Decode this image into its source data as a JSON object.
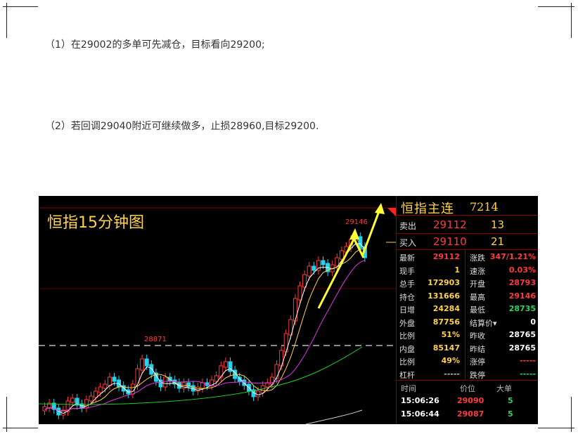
{
  "article": {
    "line1": "（1）在29002的多单可先减仓，目标看向29200;",
    "line2": "（2）若回调29040附近可继续做多，止损28960,目标29200."
  },
  "chart": {
    "title": "恒指15分钟图",
    "peak_label": "29146",
    "low_label": "28871",
    "colors": {
      "up": "#ff3b3b",
      "down": "#22d3ee",
      "ma_white": "#ffffff",
      "ma_yellow": "#ffd24d",
      "ma_magenta": "#e135e1",
      "ma_green": "#22cc22",
      "arrow": "#ffff33"
    }
  },
  "quote": {
    "title": "恒指主连",
    "code": "7214",
    "sell_label": "卖出",
    "sell_price": "29112",
    "sell_qty": "13",
    "buy_label": "买入",
    "buy_price": "29110",
    "buy_qty": "21",
    "stats": [
      {
        "l1": "最新",
        "v1": "29112",
        "c1": "red",
        "l2": "涨跌",
        "v2": "347/1.21%",
        "c2": "red"
      },
      {
        "l1": "现手",
        "v1": "1",
        "c1": "yellow",
        "l2": "速涨",
        "v2": "0.03%",
        "c2": "red"
      },
      {
        "l1": "总手",
        "v1": "172903",
        "c1": "yellow",
        "l2": "开盘",
        "v2": "28793",
        "c2": "red"
      },
      {
        "l1": "持仓",
        "v1": "131666",
        "c1": "yellow",
        "l2": "最高",
        "v2": "29146",
        "c2": "red"
      },
      {
        "l1": "日增",
        "v1": "24284",
        "c1": "yellow",
        "l2": "最低",
        "v2": "28735",
        "c2": "green"
      },
      {
        "l1": "外盘",
        "v1": "87756",
        "c1": "yellow",
        "l2": "结算价▾",
        "v2": "0",
        "c2": "white"
      },
      {
        "l1": "比例",
        "v1": "51%",
        "c1": "yellow",
        "l2": "昨收",
        "v2": "28765",
        "c2": "white"
      },
      {
        "l1": "内盘",
        "v1": "85147",
        "c1": "yellow",
        "l2": "昨结",
        "v2": "28765",
        "c2": "white"
      },
      {
        "l1": "比例",
        "v1": "49%",
        "c1": "yellow",
        "l2": "涨停",
        "v2": "-----",
        "c2": "red"
      },
      {
        "l1": "杠杆",
        "v1": "-----",
        "c1": "gray",
        "l2": "跌停",
        "v2": "-----",
        "c2": "green"
      }
    ],
    "trades_header": {
      "time": "时间",
      "price": "价位",
      "size": "大单"
    },
    "trades": [
      {
        "time": "15:06:26",
        "price": "29090",
        "size": "5"
      },
      {
        "time": "15:06:44",
        "price": "29087",
        "size": "5"
      }
    ]
  }
}
